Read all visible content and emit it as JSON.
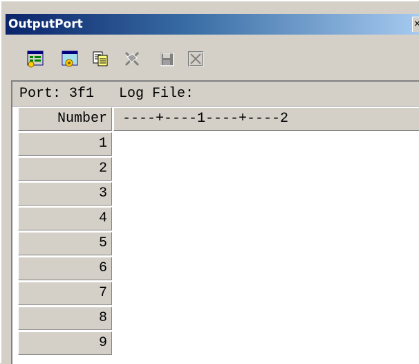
{
  "window": {
    "title": "OutputPort",
    "close_glyph": "×"
  },
  "toolbar": {
    "buttons": [
      {
        "icon": "port-settings-icon",
        "enabled": true
      },
      {
        "icon": "log-settings-icon",
        "enabled": true
      },
      {
        "icon": "copy-icon",
        "enabled": true
      },
      {
        "icon": "clear-icon",
        "enabled": false
      },
      {
        "icon": "save-icon",
        "enabled": false
      },
      {
        "icon": "close-log-icon",
        "enabled": false
      }
    ]
  },
  "infobar": {
    "text": "Port: 3f1   Log File:"
  },
  "grid": {
    "number_header": "Number",
    "ruler_header": "----+----1----+----2",
    "rows": [
      {
        "number": "1",
        "text": ""
      },
      {
        "number": "2",
        "text": ""
      },
      {
        "number": "3",
        "text": ""
      },
      {
        "number": "4",
        "text": ""
      },
      {
        "number": "5",
        "text": ""
      },
      {
        "number": "6",
        "text": ""
      },
      {
        "number": "7",
        "text": ""
      },
      {
        "number": "8",
        "text": ""
      },
      {
        "number": "9",
        "text": ""
      }
    ]
  },
  "colors": {
    "face": "#d4d0c8",
    "title_start": "#0a246a",
    "title_end": "#a6caf0"
  }
}
